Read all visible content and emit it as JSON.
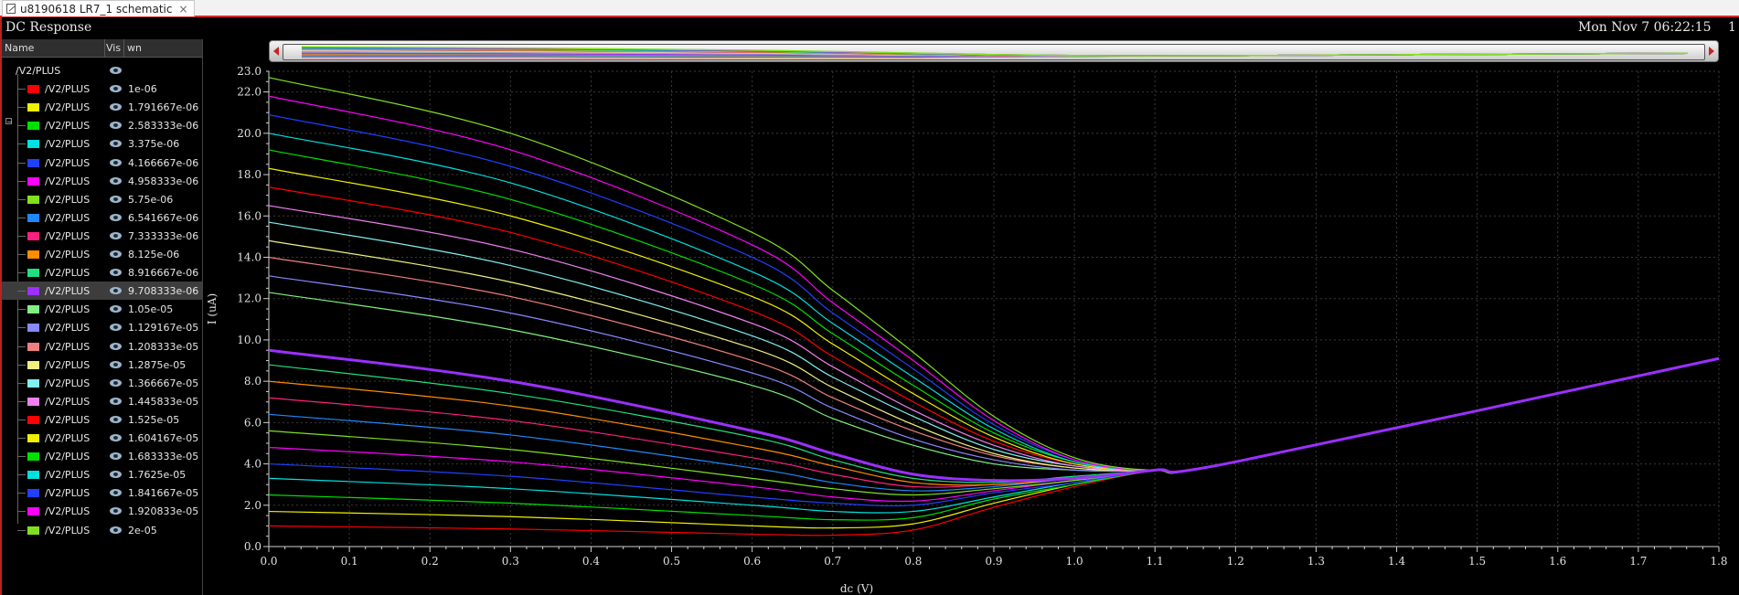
{
  "tab": {
    "title": "u8190618 LR7_1 schematic",
    "close_glyph": "×"
  },
  "window": {
    "title": "DC Response",
    "datetime": "Mon Nov 7 06:22:15",
    "page": "1"
  },
  "legend": {
    "columns": [
      "Name",
      "Vis",
      "wn"
    ],
    "group": "/V2/PLUS",
    "selected_index": 11
  },
  "chart_data": {
    "type": "line",
    "title": "DC Response",
    "xlabel": "dc (V)",
    "ylabel": "I (uA)",
    "xlim": [
      0,
      1.8
    ],
    "ylim": [
      0,
      23
    ],
    "xticks": [
      0.0,
      0.1,
      0.2,
      0.3,
      0.4,
      0.5,
      0.6,
      0.7,
      0.8,
      0.9,
      1.0,
      1.1,
      1.2,
      1.3,
      1.4,
      1.5,
      1.6,
      1.7,
      1.8
    ],
    "yticks": [
      0.0,
      2.0,
      4.0,
      6.0,
      8.0,
      10.0,
      12.0,
      14.0,
      16.0,
      18.0,
      20.0,
      22.0,
      23.0
    ],
    "grid": true,
    "legend_position": "left panel",
    "sweep_parameter": "wn",
    "tail": {
      "x": [
        1.2,
        1.8
      ],
      "y": [
        4.1,
        9.1
      ]
    },
    "series": [
      {
        "name": "/V2/PLUS",
        "wn": "1e-06",
        "color": "#ff0000",
        "x": [
          0.0,
          0.3,
          0.6,
          0.7,
          0.8,
          0.9,
          1.0,
          1.1
        ],
        "y": [
          1.0,
          0.85,
          0.6,
          0.55,
          0.8,
          1.9,
          2.9,
          3.7
        ]
      },
      {
        "name": "/V2/PLUS",
        "wn": "1.791667e-06",
        "color": "#f0f000",
        "x": [
          0.0,
          0.3,
          0.6,
          0.7,
          0.8,
          0.9,
          1.0,
          1.1
        ],
        "y": [
          1.7,
          1.45,
          1.0,
          0.9,
          1.1,
          2.1,
          3.0,
          3.7
        ]
      },
      {
        "name": "/V2/PLUS",
        "wn": "2.583333e-06",
        "color": "#00e000",
        "x": [
          0.0,
          0.3,
          0.6,
          0.7,
          0.8,
          0.9,
          1.0,
          1.1
        ],
        "y": [
          2.5,
          2.1,
          1.5,
          1.3,
          1.4,
          2.3,
          3.0,
          3.7
        ]
      },
      {
        "name": "/V2/PLUS",
        "wn": "3.375e-06",
        "color": "#00e0e0",
        "x": [
          0.0,
          0.3,
          0.6,
          0.7,
          0.8,
          0.9,
          1.0,
          1.1
        ],
        "y": [
          3.3,
          2.8,
          2.0,
          1.7,
          1.7,
          2.4,
          3.1,
          3.7
        ]
      },
      {
        "name": "/V2/PLUS",
        "wn": "4.166667e-06",
        "color": "#2040ff",
        "x": [
          0.0,
          0.3,
          0.6,
          0.7,
          0.8,
          0.9,
          1.0,
          1.1
        ],
        "y": [
          4.0,
          3.4,
          2.4,
          2.1,
          2.0,
          2.6,
          3.1,
          3.7
        ]
      },
      {
        "name": "/V2/PLUS",
        "wn": "4.958333e-06",
        "color": "#ff00ff",
        "x": [
          0.0,
          0.3,
          0.6,
          0.7,
          0.8,
          0.9,
          1.0,
          1.1
        ],
        "y": [
          4.8,
          4.1,
          2.9,
          2.4,
          2.2,
          2.7,
          3.2,
          3.7
        ]
      },
      {
        "name": "/V2/PLUS",
        "wn": "5.75e-06",
        "color": "#80e020",
        "x": [
          0.0,
          0.3,
          0.6,
          0.7,
          0.8,
          0.9,
          1.0,
          1.1
        ],
        "y": [
          5.6,
          4.7,
          3.3,
          2.8,
          2.5,
          2.8,
          3.2,
          3.7
        ]
      },
      {
        "name": "/V2/PLUS",
        "wn": "6.541667e-06",
        "color": "#2088ff",
        "x": [
          0.0,
          0.3,
          0.6,
          0.7,
          0.8,
          0.9,
          1.0,
          1.1
        ],
        "y": [
          6.4,
          5.4,
          3.8,
          3.1,
          2.7,
          2.9,
          3.3,
          3.7
        ]
      },
      {
        "name": "/V2/PLUS",
        "wn": "7.333333e-06",
        "color": "#ff2080",
        "x": [
          0.0,
          0.3,
          0.6,
          0.7,
          0.8,
          0.9,
          1.0,
          1.1
        ],
        "y": [
          7.2,
          6.1,
          4.3,
          3.5,
          2.9,
          3.0,
          3.3,
          3.7
        ]
      },
      {
        "name": "/V2/PLUS",
        "wn": "8.125e-06",
        "color": "#ff8c00",
        "x": [
          0.0,
          0.3,
          0.6,
          0.7,
          0.8,
          0.9,
          1.0,
          1.1
        ],
        "y": [
          8.0,
          6.8,
          4.8,
          3.9,
          3.1,
          3.0,
          3.3,
          3.7
        ]
      },
      {
        "name": "/V2/PLUS",
        "wn": "8.916667e-06",
        "color": "#20e080",
        "x": [
          0.0,
          0.3,
          0.6,
          0.7,
          0.8,
          0.9,
          1.0,
          1.1
        ],
        "y": [
          8.8,
          7.4,
          5.3,
          4.2,
          3.3,
          3.1,
          3.4,
          3.7
        ]
      },
      {
        "name": "/V2/PLUS",
        "wn": "9.708333e-06",
        "color": "#9b30ff",
        "x": [
          0.0,
          0.3,
          0.6,
          0.7,
          0.8,
          0.9,
          1.0,
          1.1
        ],
        "y": [
          9.5,
          8.0,
          5.6,
          4.5,
          3.5,
          3.2,
          3.3,
          3.7
        ]
      },
      {
        "name": "/V2/PLUS",
        "wn": "1.05e-05",
        "color": "#80f080",
        "x": [
          0.0,
          0.3,
          0.6,
          0.7,
          0.8,
          0.9,
          1.0,
          1.1
        ],
        "y": [
          12.3,
          10.5,
          7.8,
          6.2,
          4.9,
          4.0,
          3.7,
          3.7
        ]
      },
      {
        "name": "/V2/PLUS",
        "wn": "1.129167e-05",
        "color": "#8888ff",
        "x": [
          0.0,
          0.3,
          0.6,
          0.7,
          0.8,
          0.9,
          1.0,
          1.1
        ],
        "y": [
          13.1,
          11.3,
          8.4,
          6.7,
          5.2,
          4.2,
          3.7,
          3.7
        ]
      },
      {
        "name": "/V2/PLUS",
        "wn": "1.208333e-05",
        "color": "#f08080",
        "x": [
          0.0,
          0.3,
          0.6,
          0.7,
          0.8,
          0.9,
          1.0,
          1.1
        ],
        "y": [
          14.0,
          12.1,
          9.0,
          7.2,
          5.6,
          4.4,
          3.8,
          3.7
        ]
      },
      {
        "name": "/V2/PLUS",
        "wn": "1.2875e-05",
        "color": "#f0f080",
        "x": [
          0.0,
          0.3,
          0.6,
          0.7,
          0.8,
          0.9,
          1.0,
          1.1
        ],
        "y": [
          14.8,
          12.8,
          9.6,
          7.7,
          5.9,
          4.5,
          3.8,
          3.7
        ]
      },
      {
        "name": "/V2/PLUS",
        "wn": "1.366667e-05",
        "color": "#80f0f0",
        "x": [
          0.0,
          0.3,
          0.6,
          0.7,
          0.8,
          0.9,
          1.0,
          1.1
        ],
        "y": [
          15.7,
          13.6,
          10.2,
          8.2,
          6.3,
          4.7,
          3.9,
          3.7
        ]
      },
      {
        "name": "/V2/PLUS",
        "wn": "1.445833e-05",
        "color": "#f080f0",
        "x": [
          0.0,
          0.3,
          0.6,
          0.7,
          0.8,
          0.9,
          1.0,
          1.1
        ],
        "y": [
          16.5,
          14.4,
          10.8,
          8.7,
          6.6,
          4.9,
          3.9,
          3.7
        ]
      },
      {
        "name": "/V2/PLUS",
        "wn": "1.525e-05",
        "color": "#ff0000",
        "x": [
          0.0,
          0.3,
          0.6,
          0.7,
          0.8,
          0.9,
          1.0,
          1.1
        ],
        "y": [
          17.4,
          15.2,
          11.4,
          9.2,
          7.0,
          5.1,
          4.0,
          3.7
        ]
      },
      {
        "name": "/V2/PLUS",
        "wn": "1.604167e-05",
        "color": "#f0f000",
        "x": [
          0.0,
          0.3,
          0.6,
          0.7,
          0.8,
          0.9,
          1.0,
          1.1
        ],
        "y": [
          18.3,
          16.0,
          12.1,
          9.8,
          7.4,
          5.3,
          4.0,
          3.7
        ]
      },
      {
        "name": "/V2/PLUS",
        "wn": "1.683333e-05",
        "color": "#00e000",
        "x": [
          0.0,
          0.3,
          0.6,
          0.7,
          0.8,
          0.9,
          1.0,
          1.1
        ],
        "y": [
          19.2,
          16.8,
          12.7,
          10.3,
          7.8,
          5.5,
          4.1,
          3.7
        ]
      },
      {
        "name": "/V2/PLUS",
        "wn": "1.7625e-05",
        "color": "#00e0e0",
        "x": [
          0.0,
          0.3,
          0.6,
          0.7,
          0.8,
          0.9,
          1.0,
          1.1
        ],
        "y": [
          20.0,
          17.6,
          13.3,
          10.8,
          8.2,
          5.7,
          4.1,
          3.7
        ]
      },
      {
        "name": "/V2/PLUS",
        "wn": "1.841667e-05",
        "color": "#2040ff",
        "x": [
          0.0,
          0.3,
          0.6,
          0.7,
          0.8,
          0.9,
          1.0,
          1.1
        ],
        "y": [
          20.9,
          18.4,
          14.0,
          11.3,
          8.6,
          5.9,
          4.2,
          3.7
        ]
      },
      {
        "name": "/V2/PLUS",
        "wn": "1.920833e-05",
        "color": "#ff00ff",
        "x": [
          0.0,
          0.3,
          0.6,
          0.7,
          0.8,
          0.9,
          1.0,
          1.1
        ],
        "y": [
          21.8,
          19.2,
          14.6,
          11.8,
          9.0,
          6.1,
          4.2,
          3.7
        ]
      },
      {
        "name": "/V2/PLUS",
        "wn": "2e-05",
        "color": "#80e020",
        "x": [
          0.0,
          0.3,
          0.6,
          0.7,
          0.8,
          0.9,
          1.0,
          1.1
        ],
        "y": [
          22.7,
          20.0,
          15.2,
          12.4,
          9.4,
          6.3,
          4.3,
          3.7
        ]
      }
    ]
  }
}
